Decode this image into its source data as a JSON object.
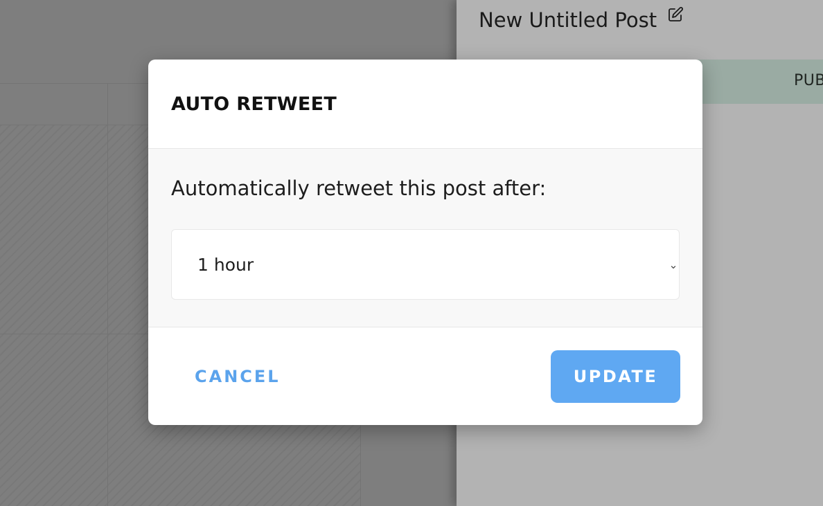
{
  "editor": {
    "post_title": "New Untitled Post",
    "tab_label": "PUB"
  },
  "modal": {
    "title": "AUTO RETWEET",
    "prompt": "Automatically retweet this post after:",
    "select": {
      "selected": "1 hour"
    },
    "cancel_label": "CANCEL",
    "update_label": "UPDATE"
  },
  "icons": {
    "edit": "pencil-square-icon",
    "chevron": "chevron-down-icon"
  },
  "colors": {
    "accent": "#5fa8f2",
    "cancel_text": "#5ba3ec",
    "tab_strip": "#9aaba3"
  }
}
